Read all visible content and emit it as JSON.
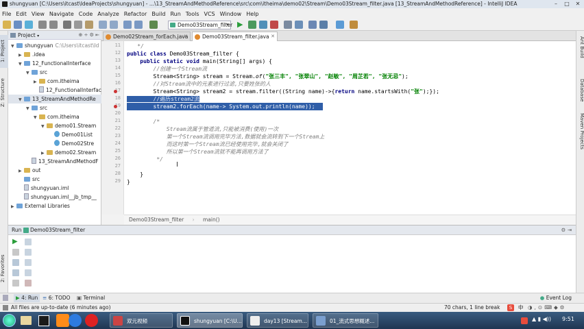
{
  "window": {
    "title": "shungyuan [C:\\Users\\itcast\\IdeaProjects\\shungyuan] - ...\\13_StreamAndMethodReference\\src\\com\\itheima\\demo02\\Stream\\Demo03Stream_filter.java [13_StreamAndMethodReference] - IntelliJ IDEA"
  },
  "menu": [
    "File",
    "Edit",
    "View",
    "Navigate",
    "Code",
    "Analyze",
    "Refactor",
    "Build",
    "Run",
    "Tools",
    "VCS",
    "Window",
    "Help"
  ],
  "toolbar": {
    "run_config": "Demo03Stream_filter"
  },
  "left_strip": {
    "project": "1: Project",
    "structure": "Z: Structure",
    "favorites": "2: Favorites"
  },
  "right_strip": {
    "ant": "Ant Build",
    "database": "Database",
    "maven": "Maven Projects"
  },
  "project": {
    "header": "Project",
    "tree": [
      {
        "label": "shungyuan",
        "extra": "C:\\Users\\itcast\\Id",
        "indent": 0,
        "icon": "folder-blue",
        "arrow": "down"
      },
      {
        "label": ".idea",
        "extra": "",
        "indent": 1,
        "icon": "folder",
        "arrow": "right"
      },
      {
        "label": "12_FunctionalInterface",
        "extra": "",
        "indent": 1,
        "icon": "folder-blue",
        "arrow": "down"
      },
      {
        "label": "src",
        "extra": "",
        "indent": 2,
        "icon": "folder-blue",
        "arrow": "down"
      },
      {
        "label": "com.itheima",
        "extra": "",
        "indent": 3,
        "icon": "folder",
        "arrow": "right"
      },
      {
        "label": "12_FunctionalInterface.",
        "extra": "",
        "indent": 3,
        "icon": "file",
        "arrow": ""
      },
      {
        "label": "13_StreamAndMethodRe",
        "extra": "",
        "indent": 1,
        "icon": "folder-blue",
        "arrow": "down"
      },
      {
        "label": "src",
        "extra": "",
        "indent": 2,
        "icon": "folder-blue",
        "arrow": "down"
      },
      {
        "label": "com.itheima",
        "extra": "",
        "indent": 3,
        "icon": "folder",
        "arrow": "down"
      },
      {
        "label": "demo01.Stream",
        "extra": "",
        "indent": 4,
        "icon": "folder",
        "arrow": "down"
      },
      {
        "label": "Demo01List",
        "extra": "",
        "indent": 5,
        "icon": "class",
        "arrow": ""
      },
      {
        "label": "Demo02Stre",
        "extra": "",
        "indent": 5,
        "icon": "class",
        "arrow": ""
      },
      {
        "label": "demo02.Stream",
        "extra": "",
        "indent": 4,
        "icon": "folder",
        "arrow": "right"
      },
      {
        "label": "13_StreamAndMethodF",
        "extra": "",
        "indent": 2,
        "icon": "file",
        "arrow": ""
      },
      {
        "label": "out",
        "extra": "",
        "indent": 1,
        "icon": "folder",
        "arrow": "right"
      },
      {
        "label": "src",
        "extra": "",
        "indent": 1,
        "icon": "folder-blue",
        "arrow": ""
      },
      {
        "label": "shungyuan.iml",
        "extra": "",
        "indent": 1,
        "icon": "file",
        "arrow": ""
      },
      {
        "label": "shungyuan.iml__jb_tmp__",
        "extra": "",
        "indent": 1,
        "icon": "file",
        "arrow": ""
      },
      {
        "label": "External Libraries",
        "extra": "",
        "indent": 0,
        "icon": "lib",
        "arrow": "right"
      }
    ]
  },
  "tabs": [
    {
      "label": "Demo02Stream_forEach.java",
      "active": false
    },
    {
      "label": "Demo03Stream_filter.java",
      "active": true
    }
  ],
  "line_numbers": [
    "11",
    "12",
    "13",
    "14",
    "15",
    "16",
    "17",
    "18",
    "19",
    "20",
    "21",
    "22",
    "23",
    "24",
    "25",
    "26",
    "27",
    "28",
    "29"
  ],
  "code": {
    "l11": "    */",
    "l12_kw": "public class ",
    "l12_rest": "Demo03Stream_filter {",
    "l13_kw": "    public static void ",
    "l13_rest": "main(String[] args) {",
    "l14": "        //创建一个Stream流",
    "l15_a": "        Stream<String> stream = Stream.",
    "l15_of": "of",
    "l15_b": "(",
    "l15_strs": "\"张三丰\", \"张翠山\", \"赵敏\", \"周芷若\", \"张无忌\"",
    "l15_c": ");",
    "l16": "        //对Stream流中的元素进行过滤,只要姓张的人",
    "l17_a": "        Stream<String> stream2 = stream.filter((String name)->{",
    "l17_kw": "return ",
    "l17_b": "name.startsWith(",
    "l17_str": "\"张\"",
    "l17_c": ");});",
    "l18": "        //遍历stream2流",
    "l19": "        stream2.forEach(name-> System.out.println(name));",
    "l21": "        /*",
    "l22": "            Stream流属于管道流,只能被消费(使用)一次",
    "l23": "            第一个Stream流调用完毕方法,数据就会流转到下一个Stream上",
    "l24": "            而这时第一个Stream流已经使用完毕,就会关闭了",
    "l25": "            所以第一个Stream流就不能再调用方法了",
    "l26": "         */",
    "l28": "    }",
    "l29": "}"
  },
  "breadcrumb": {
    "class": "Demo03Stream_filter",
    "method": "main()"
  },
  "run": {
    "label": "Run",
    "config": "Demo03Stream_filter"
  },
  "bottom_tabs": {
    "run": "4: Run",
    "todo": "6: TODO",
    "terminal": "Terminal",
    "event_log": "Event Log"
  },
  "status": {
    "left": "All files are up-to-date (6 minutes ago)",
    "right": "70 chars, 1 line break",
    "ime": "中"
  },
  "taskbar": {
    "items": [
      "双元视频",
      "shungyuan [C:\\U...",
      "day13 [Stream...",
      "01_流式思想概述..."
    ],
    "clock": "9:51"
  }
}
